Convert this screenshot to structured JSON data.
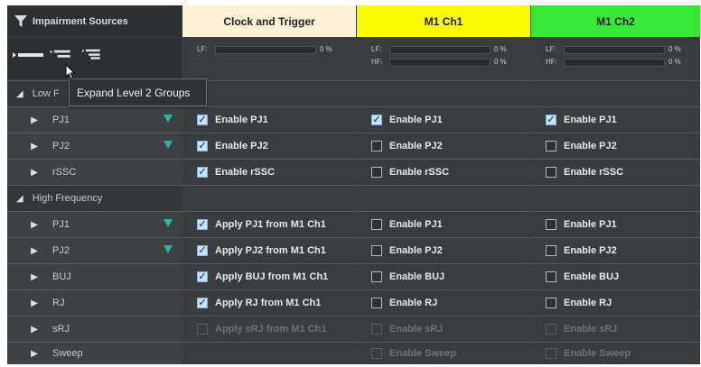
{
  "header": {
    "impairment_title": "Impairment Sources",
    "col1": "Clock and Trigger",
    "col2": "M1 Ch1",
    "col3": "M1 Ch2",
    "col1_bg": "#fdf1d6",
    "col2_bg": "#fafd00",
    "col3_bg": "#37e83a"
  },
  "meters": {
    "col1": {
      "lf_label": "LF:",
      "lf_value": "0 %"
    },
    "col2": {
      "lf_label": "LF:",
      "lf_value": "0 %",
      "hf_label": "HF:",
      "hf_value": "0 %"
    },
    "col3": {
      "lf_label": "LF:",
      "lf_value": "0 %",
      "hf_label": "HF:",
      "hf_value": "0 %"
    }
  },
  "tooltip": {
    "text": "Expand Level 2 Groups"
  },
  "groups": {
    "low": {
      "label": "Low F"
    },
    "high": {
      "label": "High Frequency"
    }
  },
  "rows": {
    "pj1_low": {
      "label": "PJ1",
      "c1": "Enable PJ1",
      "c2": "Enable PJ1",
      "c3": "Enable PJ1"
    },
    "pj2_low": {
      "label": "PJ2",
      "c1": "Enable PJ2",
      "c2": "Enable PJ2",
      "c3": "Enable PJ2"
    },
    "rssc": {
      "label": "rSSC",
      "c1": "Enable rSSC",
      "c2": "Enable rSSC",
      "c3": "Enable rSSC"
    },
    "pj1_high": {
      "label": "PJ1",
      "c1": "Apply PJ1 from M1 Ch1",
      "c2": "Enable PJ1",
      "c3": "Enable PJ1"
    },
    "pj2_high": {
      "label": "PJ2",
      "c1": "Apply PJ2 from M1 Ch1",
      "c2": "Enable PJ2",
      "c3": "Enable PJ2"
    },
    "buj": {
      "label": "BUJ",
      "c1": "Apply BUJ from M1 Ch1",
      "c2": "Enable BUJ",
      "c3": "Enable BUJ"
    },
    "rj": {
      "label": "RJ",
      "c1": "Apply RJ from M1 Ch1",
      "c2": "Enable RJ",
      "c3": "Enable RJ"
    },
    "srj": {
      "label": "sRJ",
      "c1": "Apply sRJ from M1 Ch1",
      "c2": "Enable sRJ",
      "c3": "Enable sRJ"
    },
    "sweep": {
      "label": "Sweep",
      "c2": "Enable Sweep",
      "c3": "Enable Sweep"
    }
  },
  "icons": {
    "filter": "funnel-icon",
    "expand_collapse": "tree-level-icons",
    "row_filter": "funnel-icon"
  }
}
